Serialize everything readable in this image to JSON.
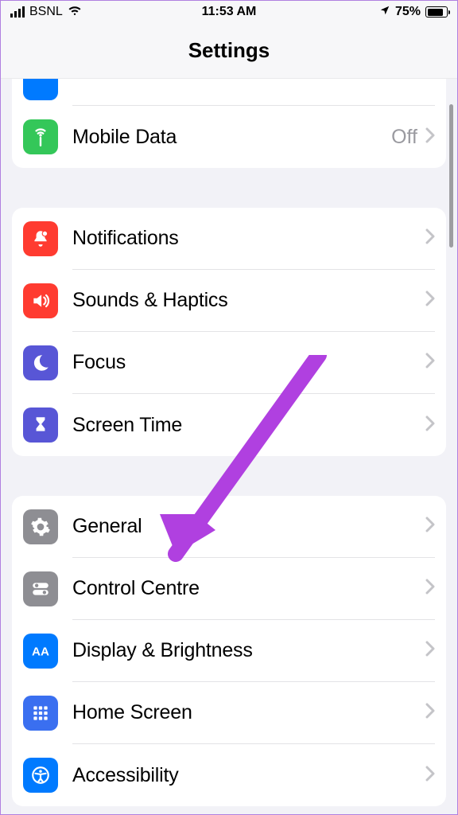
{
  "statusbar": {
    "carrier": "BSNL",
    "time": "11:53 AM",
    "battery_pct": "75%",
    "battery_fill_pct": 75
  },
  "header": {
    "title": "Settings"
  },
  "groups": [
    {
      "rows": [
        {
          "icon": "prev-icon",
          "label": ""
        },
        {
          "icon": "antenna-icon",
          "label": "Mobile Data",
          "value": "Off"
        }
      ]
    },
    {
      "rows": [
        {
          "icon": "bell-icon",
          "label": "Notifications"
        },
        {
          "icon": "speaker-icon",
          "label": "Sounds & Haptics"
        },
        {
          "icon": "moon-icon",
          "label": "Focus"
        },
        {
          "icon": "hourglass-icon",
          "label": "Screen Time"
        }
      ]
    },
    {
      "rows": [
        {
          "icon": "gear-icon",
          "label": "General"
        },
        {
          "icon": "toggles-icon",
          "label": "Control Centre"
        },
        {
          "icon": "aa-icon",
          "label": "Display & Brightness"
        },
        {
          "icon": "grid-icon",
          "label": "Home Screen"
        },
        {
          "icon": "accessibility-icon",
          "label": "Accessibility"
        }
      ]
    }
  ]
}
